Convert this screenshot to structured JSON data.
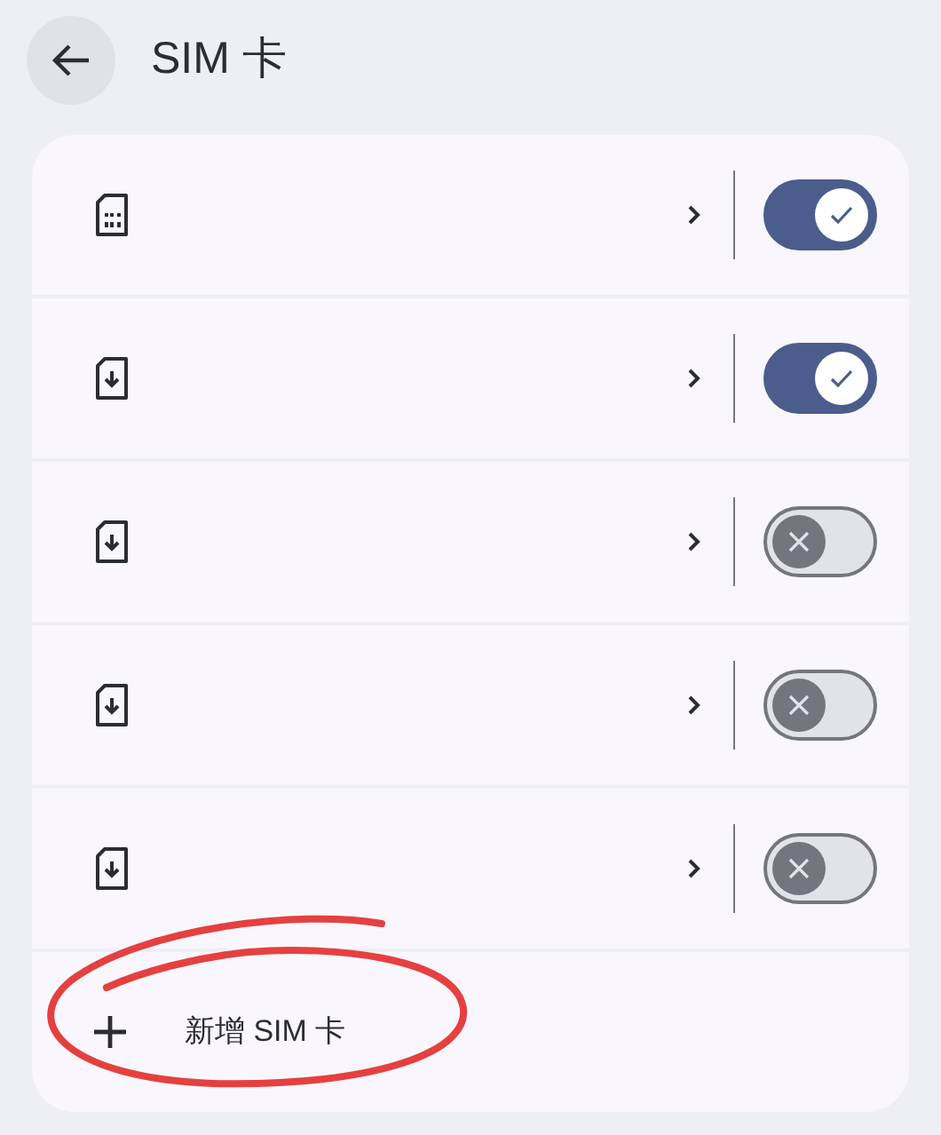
{
  "header": {
    "title": "SIM 卡"
  },
  "sims": [
    {
      "kind": "physical",
      "on": true
    },
    {
      "kind": "esim",
      "on": true
    },
    {
      "kind": "esim",
      "on": false
    },
    {
      "kind": "esim",
      "on": false
    },
    {
      "kind": "esim",
      "on": false
    }
  ],
  "add_button": {
    "label": "新增 SIM 卡",
    "circled": true
  }
}
